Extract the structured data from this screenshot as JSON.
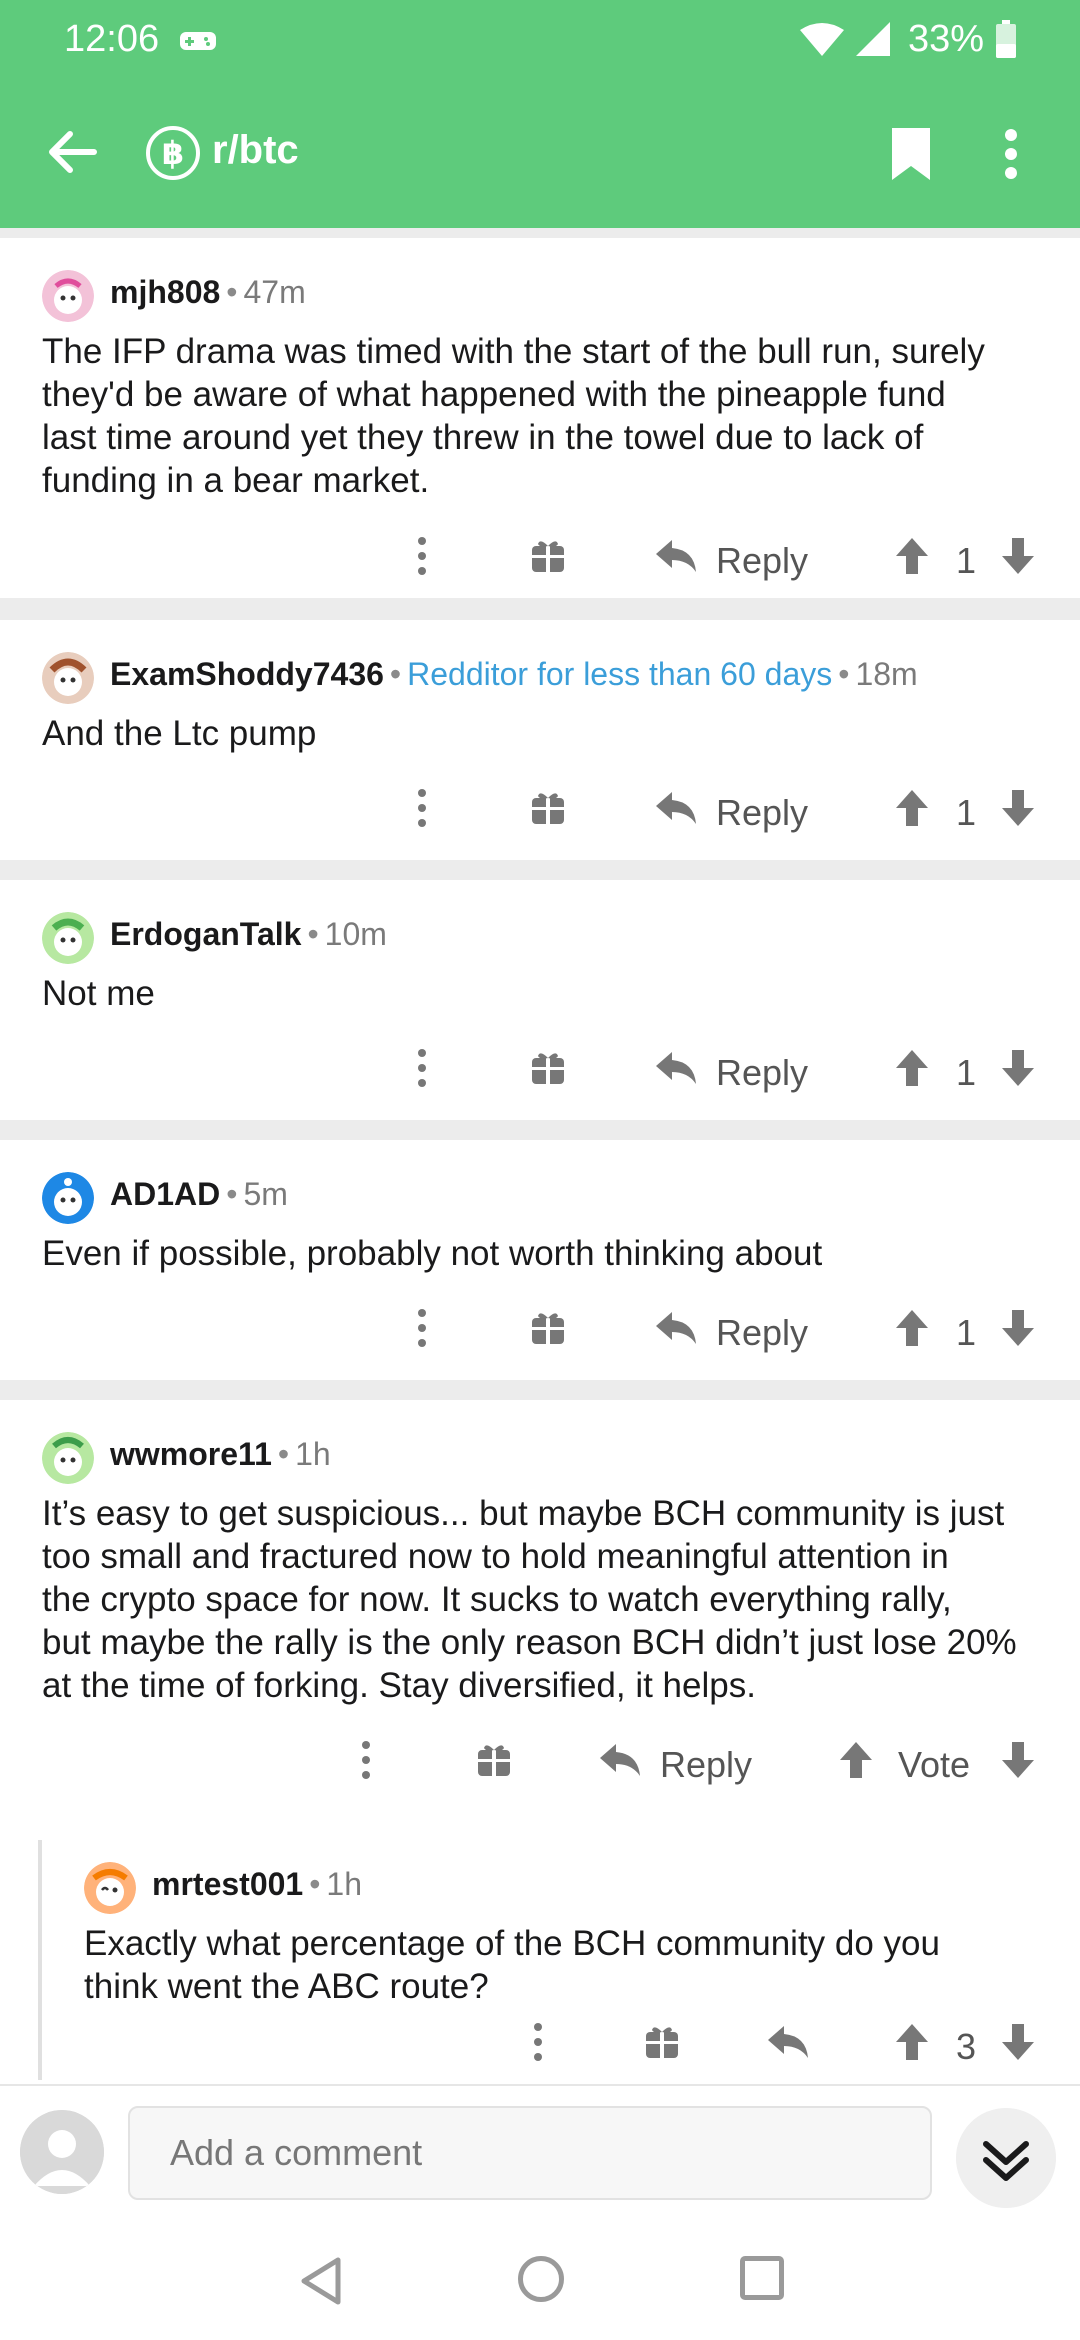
{
  "status_bar": {
    "time": "12:06",
    "battery": "33%"
  },
  "app_bar": {
    "subreddit": "r/btc",
    "sub_icon_glyph": "฿"
  },
  "actions": {
    "reply": "Reply"
  },
  "comments": [
    {
      "author": "mjh808",
      "time": "47m",
      "flair": "",
      "body_lines": [
        "The IFP drama was timed with the start of the bull run, surely",
        "they'd be aware of what happened with the pineapple fund",
        "last time around yet they threw in the towel due to lack of",
        "funding in a bear market."
      ],
      "score": "1"
    },
    {
      "author": "ExamShoddy7436",
      "time": "18m",
      "flair": "Redditor for less than 60 days",
      "body_lines": [
        "And the Ltc pump"
      ],
      "score": "1"
    },
    {
      "author": "ErdoganTalk",
      "time": "10m",
      "flair": "",
      "body_lines": [
        "Not me"
      ],
      "score": "1"
    },
    {
      "author": "AD1AD",
      "time": "5m",
      "flair": "",
      "body_lines": [
        "Even if possible, probably not worth thinking about"
      ],
      "score": "1"
    },
    {
      "author": "wwmore11",
      "time": "1h",
      "flair": "",
      "body_lines": [
        "It’s easy to get suspicious... but maybe BCH community is just",
        "too small and fractured now to hold meaningful attention in",
        "the crypto space for now. It sucks to watch everything rally,",
        "but maybe the rally is the only reason BCH didn’t just lose 20%",
        "at the time of forking. Stay diversified, it helps."
      ],
      "score": "Vote"
    },
    {
      "author": "mrtest001",
      "time": "1h",
      "flair": "",
      "body_lines": [
        "Exactly what percentage of the BCH community do you",
        "think went the ABC route?"
      ],
      "score": "3"
    }
  ],
  "composer": {
    "placeholder": "Add a comment"
  },
  "colors": {
    "accent": "#5ecb7c",
    "flair": "#3b9ed9"
  }
}
